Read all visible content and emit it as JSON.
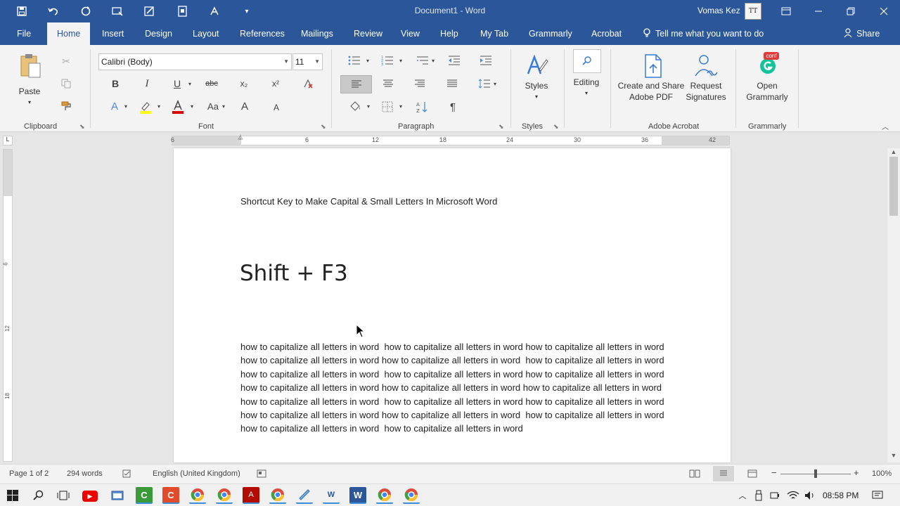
{
  "window": {
    "title": "Document1 - Word",
    "user_name": "Vomas Kez",
    "avatar_text": "TT"
  },
  "quick_access": [
    "save-icon",
    "undo-icon",
    "redo-icon",
    "present-icon",
    "edit-icon",
    "layout-icon",
    "format-icon",
    "customize-icon"
  ],
  "tabs": [
    {
      "label": "File"
    },
    {
      "label": "Home"
    },
    {
      "label": "Insert"
    },
    {
      "label": "Design"
    },
    {
      "label": "Layout"
    },
    {
      "label": "References"
    },
    {
      "label": "Mailings"
    },
    {
      "label": "Review"
    },
    {
      "label": "View"
    },
    {
      "label": "Help"
    },
    {
      "label": "My Tab"
    },
    {
      "label": "Grammarly"
    },
    {
      "label": "Acrobat"
    }
  ],
  "active_tab": "Home",
  "tell_me": "Tell me what you want to do",
  "share": "Share",
  "ribbon": {
    "clipboard": {
      "label": "Clipboard",
      "paste": "Paste"
    },
    "font": {
      "label": "Font",
      "font_name": "Calibri (Body)",
      "font_size": "11",
      "bold": "B",
      "italic": "I",
      "underline": "U",
      "strike": "abc",
      "subscript": "x₂",
      "superscript": "x²",
      "change_case": "Aa",
      "grow": "A",
      "shrink": "A",
      "highlight_color": "#ffff00",
      "font_color": "#e00000"
    },
    "paragraph": {
      "label": "Paragraph",
      "pilcrow": "¶"
    },
    "styles": {
      "label": "Styles",
      "button": "Styles"
    },
    "editing": {
      "button": "Editing"
    },
    "adobe": {
      "label": "Adobe Acrobat",
      "create_line1": "Create and Share",
      "create_line2": "Adobe PDF",
      "request_line1": "Request",
      "request_line2": "Signatures"
    },
    "grammarly": {
      "label": "Grammarly",
      "open_line1": "Open",
      "open_line2": "Grammarly",
      "badge": "conf"
    }
  },
  "ruler": {
    "numbers": [
      "6",
      "6",
      "12",
      "18",
      "24",
      "30",
      "36",
      "42"
    ],
    "vertical_numbers": [
      "6",
      "12",
      "18"
    ]
  },
  "document": {
    "subtitle": "Shortcut Key to Make Capital & Small Letters In Microsoft Word",
    "heading": "Shift + F3",
    "body": "how to capitalize all letters in word  how to capitalize all letters in word how to capitalize all letters in word  how to capitalize all letters in word how to capitalize all letters in word  how to capitalize all letters in word how to capitalize all letters in word  how to capitalize all letters in word how to capitalize all letters in word  how to capitalize all letters in word how to capitalize all letters in word how to capitalize all letters in word how to capitalize all letters in word  how to capitalize all letters in word how to capitalize all letters in word  how to capitalize all letters in word how to capitalize all letters in word  how to capitalize all letters in word how to capitalize all letters in word  how to capitalize all letters in word"
  },
  "status": {
    "page": "Page 1 of 2",
    "words": "294 words",
    "language": "English (United Kingdom)",
    "zoom": "100%",
    "zoom_level": 100
  },
  "taskbar": {
    "time": "08:58 PM"
  },
  "colors": {
    "title_bar": "#2b579a",
    "ribbon": "#f3f3f3",
    "accent": "#2b579a"
  }
}
